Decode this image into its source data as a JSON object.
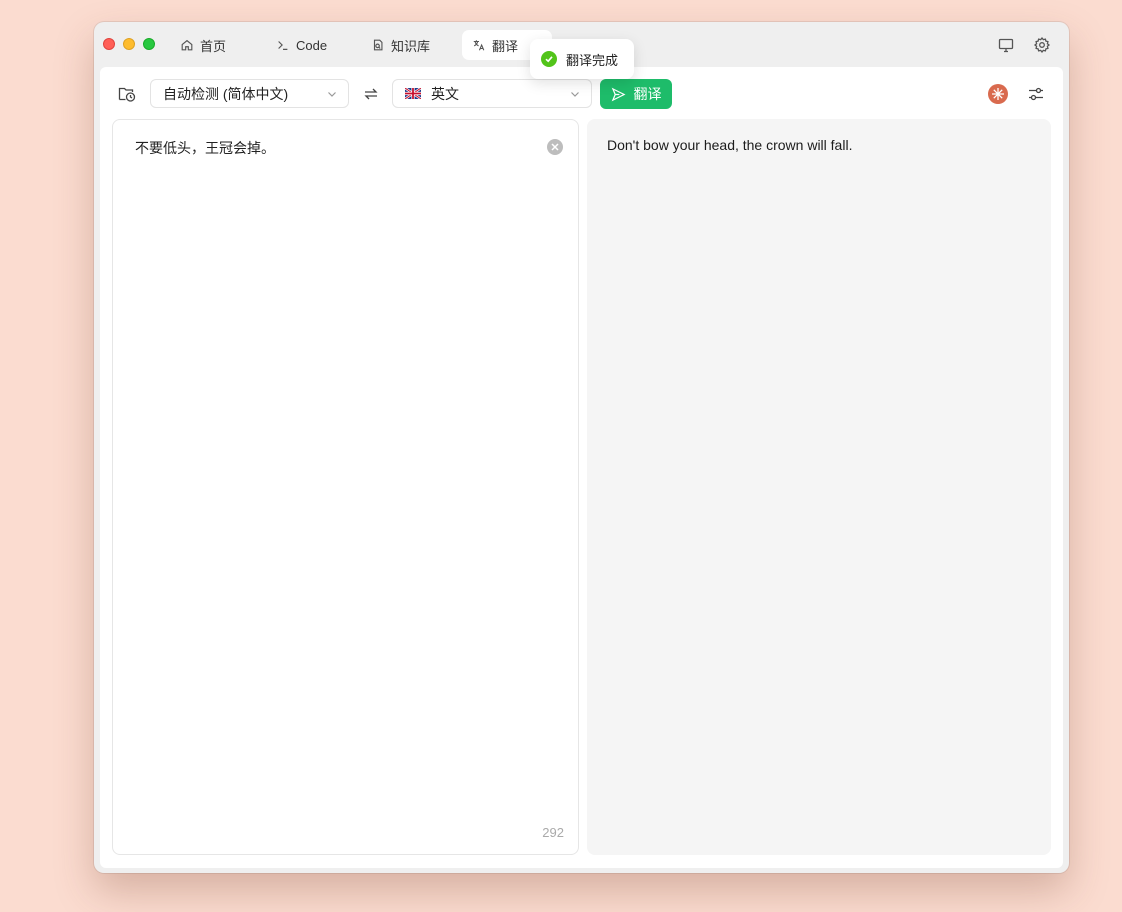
{
  "tabs": [
    {
      "label": "首页",
      "icon": "home-icon"
    },
    {
      "label": "Code",
      "icon": "terminal-icon"
    },
    {
      "label": "知识库",
      "icon": "knowledge-icon"
    },
    {
      "label": "翻译",
      "icon": "translate-icon",
      "active": true
    }
  ],
  "toast": {
    "message": "翻译完成",
    "status_color": "#52c41a"
  },
  "toolbar": {
    "source_language": "自动检测 (简体中文)",
    "target_language": "英文",
    "target_flag": "uk-flag",
    "translate_label": "翻译",
    "accent_color": "#1ebc6a"
  },
  "source": {
    "text": "不要低头，王冠会掉。",
    "char_count": "292"
  },
  "result": {
    "text": "Don't bow your head, the crown will fall."
  }
}
